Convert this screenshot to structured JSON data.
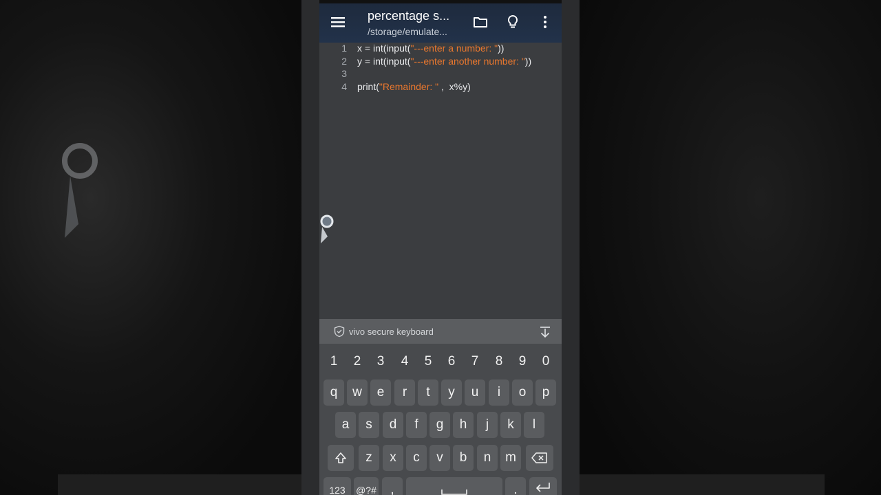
{
  "header": {
    "title": "percentage s...",
    "subtitle": "/storage/emulate..."
  },
  "icons": {
    "menu": "menu-icon",
    "folder": "folder-icon",
    "bulb": "lightbulb-icon",
    "more": "more-vert-icon",
    "shield": "shield-icon",
    "hide": "keyboard-hide-icon",
    "shift": "shift-icon",
    "backspace": "backspace-icon",
    "enter": "enter-icon"
  },
  "editor": {
    "lines": [
      {
        "num": "1",
        "pre": "x = int(input(",
        "str": "\"---enter a number: \"",
        "post": "))"
      },
      {
        "num": "2",
        "pre": "y = int(input(",
        "str": "\"---enter another number: \"",
        "post": "))"
      },
      {
        "num": "3",
        "pre": "",
        "str": "",
        "post": ""
      },
      {
        "num": "4",
        "pre": "print(",
        "str": "\"Remainder: \"",
        "post": " ,  x%y)"
      }
    ]
  },
  "keyboard": {
    "label": "vivo secure keyboard",
    "row_numbers": [
      "1",
      "2",
      "3",
      "4",
      "5",
      "6",
      "7",
      "8",
      "9",
      "0"
    ],
    "row_top": [
      "q",
      "w",
      "e",
      "r",
      "t",
      "y",
      "u",
      "i",
      "o",
      "p"
    ],
    "row_middle": [
      "a",
      "s",
      "d",
      "f",
      "g",
      "h",
      "j",
      "k",
      "l"
    ],
    "row_bottom": [
      "z",
      "x",
      "c",
      "v",
      "b",
      "n",
      "m"
    ],
    "key_123": "123",
    "key_symbols": "@?#",
    "key_comma": ",",
    "key_period": "."
  },
  "colors": {
    "string": "#e8772e",
    "toolbar": "#22324a",
    "editor_bg": "#3b3d40",
    "keyboard_bg": "#484a4d"
  }
}
